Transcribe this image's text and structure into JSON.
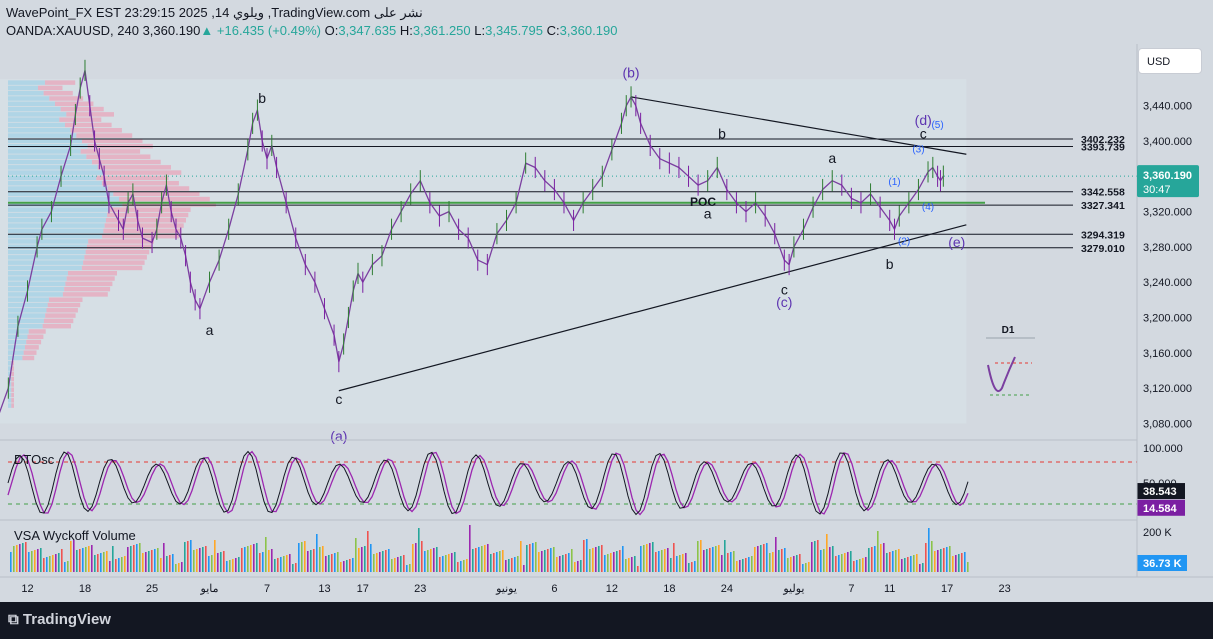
{
  "header": {
    "line1": "WavePoint_FX EST 23:29:15 2025 ,14 ويلوي ,TradingView.com نشر على",
    "symbol": "OANDA:XAUUSD, 240",
    "last": "3,360.190",
    "change": "+16.435 (+0.49%)",
    "o_label": "O:",
    "o": "3,347.635",
    "h_label": "H:",
    "h": "3,361.250",
    "l_label": "L:",
    "l": "3,345.795",
    "c_label": "C:",
    "c": "3,360.190",
    "currency_button": "USD"
  },
  "footer": {
    "brand": "TradingView"
  },
  "chart_data": {
    "type": "line",
    "symbol": "OANDA:XAUUSD",
    "interval": "240",
    "y_axis_ticks": [
      3080,
      3120,
      3160,
      3200,
      3240,
      3280,
      3320,
      3360,
      3400,
      3440
    ],
    "y_axis_tick_labels": [
      "3,080.000",
      "3,120.000",
      "3,160.000",
      "3,200.000",
      "3,240.000",
      "3,280.000",
      "3,320.000",
      "3,360.000",
      "3,400.000",
      "3,440.000"
    ],
    "ylim": [
      3060,
      3490
    ],
    "x_axis_ticks": [
      {
        "label": "12",
        "day": -18
      },
      {
        "label": "18",
        "day": -12
      },
      {
        "label": "25",
        "day": -5
      },
      {
        "label": "مايو",
        "day": 1
      },
      {
        "label": "7",
        "day": 7
      },
      {
        "label": "13",
        "day": 13
      },
      {
        "label": "17",
        "day": 17
      },
      {
        "label": "23",
        "day": 23
      },
      {
        "label": "يونيو",
        "day": 32
      },
      {
        "label": "6",
        "day": 37
      },
      {
        "label": "12",
        "day": 43
      },
      {
        "label": "18",
        "day": 49
      },
      {
        "label": "24",
        "day": 55
      },
      {
        "label": "يوليو",
        "day": 62
      },
      {
        "label": "7",
        "day": 68
      },
      {
        "label": "11",
        "day": 72
      },
      {
        "label": "17",
        "day": 78
      },
      {
        "label": "23",
        "day": 84
      }
    ],
    "price_path": [
      [
        -21.5,
        3060
      ],
      [
        -21,
        3090
      ],
      [
        -20,
        3120
      ],
      [
        -19,
        3190
      ],
      [
        -18,
        3230
      ],
      [
        -17,
        3280
      ],
      [
        -16.5,
        3300
      ],
      [
        -15.5,
        3320
      ],
      [
        -14.5,
        3360
      ],
      [
        -13.5,
        3395
      ],
      [
        -13,
        3430
      ],
      [
        -12.5,
        3460
      ],
      [
        -12,
        3480
      ],
      [
        -11.5,
        3440
      ],
      [
        -11,
        3400
      ],
      [
        -10.5,
        3380
      ],
      [
        -10,
        3360
      ],
      [
        -9.5,
        3330
      ],
      [
        -8.5,
        3310
      ],
      [
        -8,
        3300
      ],
      [
        -7.5,
        3330
      ],
      [
        -7,
        3340
      ],
      [
        -6.5,
        3310
      ],
      [
        -6,
        3290
      ],
      [
        -5,
        3285
      ],
      [
        -4.5,
        3300
      ],
      [
        -4,
        3330
      ],
      [
        -3.5,
        3350
      ],
      [
        -3,
        3320
      ],
      [
        -2.5,
        3300
      ],
      [
        -2,
        3290
      ],
      [
        -1.5,
        3270
      ],
      [
        -1,
        3240
      ],
      [
        -0.5,
        3220
      ],
      [
        0,
        3210
      ],
      [
        1,
        3240
      ],
      [
        2,
        3265
      ],
      [
        3,
        3300
      ],
      [
        4,
        3340
      ],
      [
        5,
        3390
      ],
      [
        5.5,
        3420
      ],
      [
        6,
        3435
      ],
      [
        6.5,
        3400
      ],
      [
        7,
        3380
      ],
      [
        7.5,
        3395
      ],
      [
        8,
        3370
      ],
      [
        9,
        3330
      ],
      [
        10,
        3290
      ],
      [
        11,
        3260
      ],
      [
        12,
        3240
      ],
      [
        13,
        3210
      ],
      [
        14,
        3180
      ],
      [
        14.5,
        3150
      ],
      [
        15,
        3170
      ],
      [
        15.5,
        3200
      ],
      [
        16,
        3230
      ],
      [
        16.5,
        3250
      ],
      [
        17,
        3240
      ],
      [
        18,
        3260
      ],
      [
        19,
        3270
      ],
      [
        20,
        3300
      ],
      [
        21,
        3320
      ],
      [
        22,
        3340
      ],
      [
        23,
        3355
      ],
      [
        24,
        3330
      ],
      [
        25,
        3315
      ],
      [
        26,
        3320
      ],
      [
        27,
        3300
      ],
      [
        28,
        3290
      ],
      [
        29,
        3265
      ],
      [
        30,
        3260
      ],
      [
        31,
        3295
      ],
      [
        32,
        3310
      ],
      [
        33,
        3330
      ],
      [
        34,
        3375
      ],
      [
        35,
        3370
      ],
      [
        36,
        3355
      ],
      [
        37,
        3345
      ],
      [
        38,
        3330
      ],
      [
        39,
        3310
      ],
      [
        40,
        3330
      ],
      [
        41,
        3345
      ],
      [
        42,
        3360
      ],
      [
        43,
        3390
      ],
      [
        44,
        3420
      ],
      [
        44.5,
        3440
      ],
      [
        45,
        3450
      ],
      [
        45.5,
        3440
      ],
      [
        46,
        3420
      ],
      [
        47,
        3395
      ],
      [
        48,
        3380
      ],
      [
        49,
        3375
      ],
      [
        50,
        3370
      ],
      [
        51,
        3360
      ],
      [
        52,
        3350
      ],
      [
        53,
        3355
      ],
      [
        54,
        3370
      ],
      [
        55,
        3345
      ],
      [
        56,
        3330
      ],
      [
        57,
        3320
      ],
      [
        58,
        3330
      ],
      [
        59,
        3315
      ],
      [
        60,
        3295
      ],
      [
        61,
        3265
      ],
      [
        61.5,
        3260
      ],
      [
        62,
        3280
      ],
      [
        63,
        3300
      ],
      [
        64,
        3325
      ],
      [
        65,
        3345
      ],
      [
        66,
        3355
      ],
      [
        67,
        3350
      ],
      [
        68,
        3335
      ],
      [
        69,
        3330
      ],
      [
        70,
        3340
      ],
      [
        71,
        3325
      ],
      [
        72,
        3310
      ],
      [
        72.5,
        3300
      ],
      [
        73,
        3315
      ],
      [
        74,
        3330
      ],
      [
        75,
        3345
      ],
      [
        76,
        3365
      ],
      [
        76.5,
        3370
      ],
      [
        77,
        3360
      ],
      [
        77.3,
        3355
      ],
      [
        77.6,
        3360.19
      ]
    ],
    "horizontal_levels": [
      {
        "value": 3402.232,
        "label": "3402.232"
      },
      {
        "value": 3393.739,
        "label": "3393.739"
      },
      {
        "value": 3342.558,
        "label": "3342.558"
      },
      {
        "value": 3327.341,
        "label": "3327.341"
      },
      {
        "value": 3294.319,
        "label": "3294.319"
      },
      {
        "value": 3279.01,
        "label": "3279.010"
      }
    ],
    "poc": {
      "label": "POC",
      "value": 3330
    },
    "triangle_lines": [
      {
        "from": [
          45,
          3450
        ],
        "to": [
          80,
          3385
        ]
      },
      {
        "from": [
          14.5,
          3117
        ],
        "to": [
          80,
          3305
        ]
      }
    ],
    "wave_labels": [
      {
        "text": "(b)",
        "day": 45,
        "value": 3472,
        "color": "#5e35b1"
      },
      {
        "text": "(a)",
        "day": 14.5,
        "value": 3060,
        "color": "#5e35b1"
      },
      {
        "text": "(c)",
        "day": 61,
        "value": 3212,
        "color": "#5e35b1"
      },
      {
        "text": "(d)",
        "day": 75.5,
        "value": 3418,
        "color": "#5e35b1"
      },
      {
        "text": "(e)",
        "day": 79,
        "value": 3280,
        "color": "#5e35b1"
      },
      {
        "text": "b",
        "day": 6.5,
        "value": 3443,
        "color": "#131722"
      },
      {
        "text": "a",
        "day": 1,
        "value": 3180,
        "color": "#131722"
      },
      {
        "text": "c",
        "day": 14.5,
        "value": 3102,
        "color": "#131722"
      },
      {
        "text": "b",
        "day": 54.5,
        "value": 3403,
        "color": "#131722"
      },
      {
        "text": "a",
        "day": 53,
        "value": 3312,
        "color": "#131722"
      },
      {
        "text": "c",
        "day": 61,
        "value": 3226,
        "color": "#131722"
      },
      {
        "text": "a",
        "day": 66,
        "value": 3375,
        "color": "#131722"
      },
      {
        "text": "b",
        "day": 72,
        "value": 3255,
        "color": "#131722"
      },
      {
        "text": "c",
        "day": 75.5,
        "value": 3403,
        "color": "#131722"
      },
      {
        "text": "(1)",
        "day": 72.5,
        "value": 3350,
        "color": "#2962ff"
      },
      {
        "text": "(2)",
        "day": 73.5,
        "value": 3283,
        "color": "#2962ff"
      },
      {
        "text": "(3)",
        "day": 75,
        "value": 3387,
        "color": "#2962ff"
      },
      {
        "text": "(4)",
        "day": 76,
        "value": 3322,
        "color": "#2962ff"
      },
      {
        "text": "(5)",
        "day": 77,
        "value": 3415,
        "color": "#2962ff"
      }
    ],
    "current_price": {
      "value": "3,360.190",
      "countdown": "30:47"
    },
    "inset_label": "D1",
    "indicators": [
      {
        "name": "DTOsc",
        "y_ticks": [
          "100.000",
          "50.000"
        ],
        "levels": [
          80,
          20
        ],
        "values": [
          {
            "value": "38.543",
            "color": "#131722"
          },
          {
            "value": "14.584",
            "color": "#7b1fa2"
          }
        ]
      },
      {
        "name": "VSA Wyckoff Volume",
        "y_ticks": [
          "200 K"
        ],
        "values": [
          {
            "value": "36.73 K",
            "color": "#2196f3"
          }
        ]
      }
    ]
  }
}
